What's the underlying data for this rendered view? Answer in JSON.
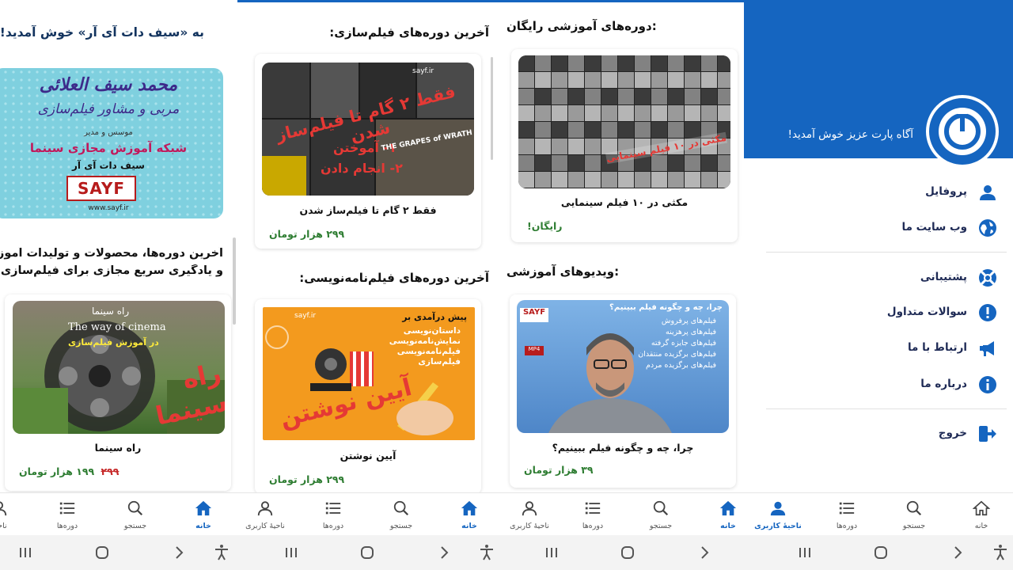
{
  "panel_left": {
    "welcome": "به «سیف دات آی آر» خوش آمدید!",
    "banner": {
      "name": "محمد سیف العلائی",
      "role": "مربی و مشاور فیلم‌سازی",
      "founder": "موسس و مدیر",
      "network": "شبکه آموزش مجازی سینما",
      "site": "سیف دات آی آر",
      "logo": "SAYF",
      "url": "www.sayf.ir"
    },
    "latest_line1": "آخرین دوره‌ها، محصولات و تولیدات آموزشی",
    "latest_line2": "و یادگیری سریع مجازی برای فیلم‌سازی:",
    "card": {
      "title": "راه سینما",
      "old_price": "۲۹۹",
      "price": "۱۹۹ هزار تومان",
      "overlay_top": "راه سینما",
      "overlay_en": "The way of cinema",
      "overlay_sub": "در آموزش فیلم‌سازی",
      "overlay_big": "راه سینما"
    }
  },
  "panel_mid": {
    "filmmaking_title": "آخرین دوره‌های فیلم‌سازی:",
    "filmmaking_card": {
      "title": "فقط ۲ گام تا فیلم‌ساز شدن",
      "price": "۲۹۹ هزار تومان",
      "overlay_main": "فقط ۲ گام تا فیلم‌ساز شدن",
      "overlay_step1": "۱- آموختن",
      "overlay_step2": "۲- انجام دادن",
      "poster_text": "THE GRAPES of WRATH",
      "site_tag": "sayf.ir"
    },
    "screenwriting_title": "آخرین دوره‌های فیلم‌نامه‌نویسی:",
    "screenwriting_card": {
      "title": "آیین نوشتن",
      "price": "۲۹۹ هزار تومان",
      "overlay_intro": "پیش درآمدی بر",
      "overlay_lines": [
        "داستان‌نویسی",
        "نمایش‌نامه‌نویسی",
        "فیلم‌نامه‌نویسی",
        "فیلم‌سازی"
      ],
      "overlay_big": "آیین نوشتن",
      "site_tag": "sayf.ir"
    }
  },
  "panel_right": {
    "free_title": "دوره‌های آموزشی رایگان:",
    "free_card": {
      "title": "مکثی در ۱۰ فیلم سینمایی",
      "price": "رایگان!",
      "overlay": "مکثی در ۱۰ فیلم سینمایی"
    },
    "videos_title": "ویدیوهای آموزشی:",
    "video_card": {
      "title": "چرا، چه و چگونه فیلم ببینیم؟",
      "price": "۳۹ هزار تومان",
      "overlay_q": "چرا، چه و چگونه فیلم ببینیم؟",
      "overlay_list": [
        "فیلم‌های پرفروش",
        "فیلم‌های پرهزینه",
        "فیلم‌های جایزه گرفته",
        "فیلم‌های برگزیده منتقدان",
        "فیلم‌های برگزیده مردم"
      ],
      "logo": "SAYF",
      "badge": "MP4"
    }
  },
  "drawer": {
    "greeting": "آگاه پارت عزیز خوش آمدید!",
    "items": [
      {
        "label": "پروفایل",
        "icon": "user-icon"
      },
      {
        "label": "وب سایت ما",
        "icon": "globe-icon"
      },
      {
        "label": "پشتیبانی",
        "icon": "lifebuoy-icon"
      },
      {
        "label": "سوالات متداول",
        "icon": "info-icon"
      },
      {
        "label": "ارتباط با ما",
        "icon": "megaphone-icon"
      },
      {
        "label": "درباره ما",
        "icon": "info-circle-icon"
      },
      {
        "label": "خروج",
        "icon": "logout-icon"
      }
    ]
  },
  "nav": {
    "home": "خانه",
    "search": "جستجو",
    "courses": "دوره‌ها",
    "account": "ناحیهٔ کاربری",
    "account_partial": "ناحیهٔ"
  },
  "colors": {
    "primary": "#1565c0",
    "price_green": "#2e7d32",
    "old_price_red": "#c62828",
    "text_dark": "#1e2a55"
  }
}
